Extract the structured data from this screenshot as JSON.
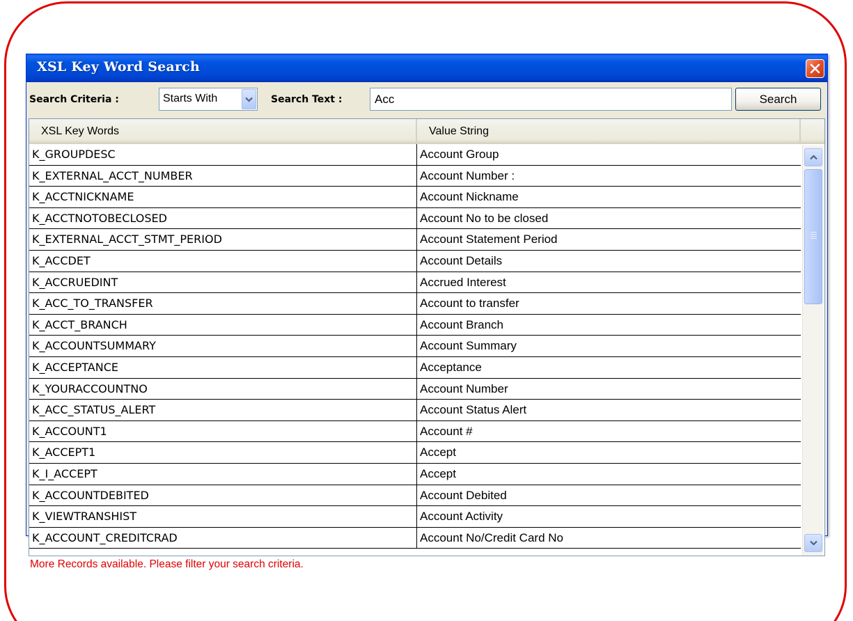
{
  "window": {
    "title": "XSL Key Word Search",
    "close_icon": "close-x-icon"
  },
  "toolbar": {
    "criteria_label": "Search Criteria :",
    "criteria_value": "Starts With",
    "text_label": "Search Text :",
    "text_value": "Acc",
    "search_button": "Search"
  },
  "grid": {
    "columns": [
      "XSL Key Words",
      "Value String"
    ],
    "rows": [
      {
        "key": "K_GROUPDESC",
        "value": "Account Group"
      },
      {
        "key": "K_EXTERNAL_ACCT_NUMBER",
        "value": "Account Number :"
      },
      {
        "key": "K_ACCTNICKNAME",
        "value": "Account Nickname"
      },
      {
        "key": "K_ACCTNOTOBECLOSED",
        "value": "Account No to be closed"
      },
      {
        "key": "K_EXTERNAL_ACCT_STMT_PERIOD",
        "value": "Account Statement Period"
      },
      {
        "key": "K_ACCDET",
        "value": "Account Details"
      },
      {
        "key": "K_ACCRUEDINT",
        "value": "Accrued Interest"
      },
      {
        "key": "K_ACC_TO_TRANSFER",
        "value": "Account to transfer"
      },
      {
        "key": "K_ACCT_BRANCH",
        "value": "Account Branch"
      },
      {
        "key": "K_ACCOUNTSUMMARY",
        "value": "Account Summary"
      },
      {
        "key": "K_ACCEPTANCE",
        "value": "Acceptance"
      },
      {
        "key": "K_YOURACCOUNTNO",
        "value": "Account Number"
      },
      {
        "key": "K_ACC_STATUS_ALERT",
        "value": "Account Status Alert"
      },
      {
        "key": "K_ACCOUNT1",
        "value": "Account #"
      },
      {
        "key": "K_ACCEPT1",
        "value": "Accept"
      },
      {
        "key": "K_I_ACCEPT",
        "value": "Accept"
      },
      {
        "key": "K_ACCOUNTDEBITED",
        "value": "Account Debited"
      },
      {
        "key": "K_VIEWTRANSHIST",
        "value": "Account Activity"
      },
      {
        "key": "K_ACCOUNT_CREDITCRAD",
        "value": "Account No/Credit Card No"
      }
    ]
  },
  "status": {
    "message": "More Records available. Please filter your search criteria."
  },
  "colors": {
    "titlebar": "#0053e1",
    "highlight_border": "#e00000",
    "status_text": "#e00000",
    "dialog_face": "#ece9d8"
  }
}
